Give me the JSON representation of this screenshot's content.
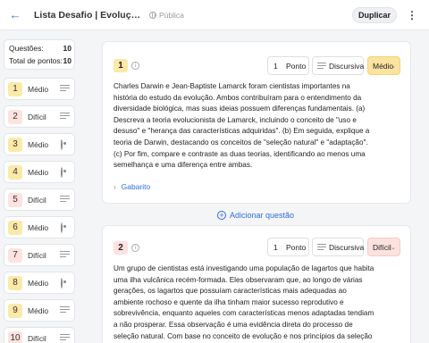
{
  "header": {
    "title": "Lista Desafio | Evolução: In...",
    "visibility": "Pública",
    "duplicate_label": "Duplicar"
  },
  "summary": {
    "questions_label": "Questões:",
    "questions_value": "10",
    "points_label": "Total de pontos:",
    "points_value": "10"
  },
  "sidebar_items": [
    {
      "num": "1",
      "level": "Médio",
      "type": "text-lines-icon"
    },
    {
      "num": "2",
      "level": "Difícil",
      "type": "text-lines-icon"
    },
    {
      "num": "3",
      "level": "Médio",
      "type": "radio-icon"
    },
    {
      "num": "4",
      "level": "Médio",
      "type": "radio-icon"
    },
    {
      "num": "5",
      "level": "Difícil",
      "type": "text-lines-icon"
    },
    {
      "num": "6",
      "level": "Médio",
      "type": "radio-icon"
    },
    {
      "num": "7",
      "level": "Difícil",
      "type": "text-lines-icon"
    },
    {
      "num": "8",
      "level": "Médio",
      "type": "radio-icon"
    },
    {
      "num": "9",
      "level": "Médio",
      "type": "text-lines-icon"
    },
    {
      "num": "10",
      "level": "Difícil",
      "type": "text-lines-icon"
    }
  ],
  "questions": [
    {
      "num": "1",
      "points_value": "1",
      "points_label": "Ponto",
      "type_label": "Discursiva",
      "level": "Médio",
      "statement": "Charles Darwin e Jean-Baptiste Lamarck foram cientistas importantes na história do estudo da evolução. Ambos contribuíram para o entendimento da diversidade biológica, mas suas ideias possuem diferenças fundamentais. (a) Descreva a teoria evolucionista de Lamarck, incluindo o conceito de \"uso e desuso\" e \"herança das características adquiridas\". (b) Em seguida, explique a teoria de Darwin, destacando os conceitos de \"seleção natural\" e \"adaptação\". (c) Por fim, compare e contraste as duas teorias, identificando ao menos uma semelhança e uma diferença entre ambas.",
      "answer_label": "Gabarito"
    },
    {
      "num": "2",
      "points_value": "1",
      "points_label": "Ponto",
      "type_label": "Discursiva",
      "level": "Difícil",
      "statement": "Um grupo de cientistas está investigando uma população de lagartos que habita uma ilha vulcânica recém-formada. Eles observaram que, ao longo de várias gerações, os lagartos que possuíam características mais adequadas ao ambiente rochoso e quente da ilha tinham maior sucesso reprodutivo e sobrevivência, enquanto aqueles com características menos adaptadas tendiam a não prosperar. Essa observação é uma evidência direta do processo de seleção natural. Com base no conceito de evolução e nos princípios da seleção natural propostos por Charles"
    }
  ],
  "add_question_label": "Adicionar questão",
  "colors": {
    "accent": "#2f6fd6",
    "medio": "#fbe9a8",
    "dificil": "#fde2e0"
  }
}
